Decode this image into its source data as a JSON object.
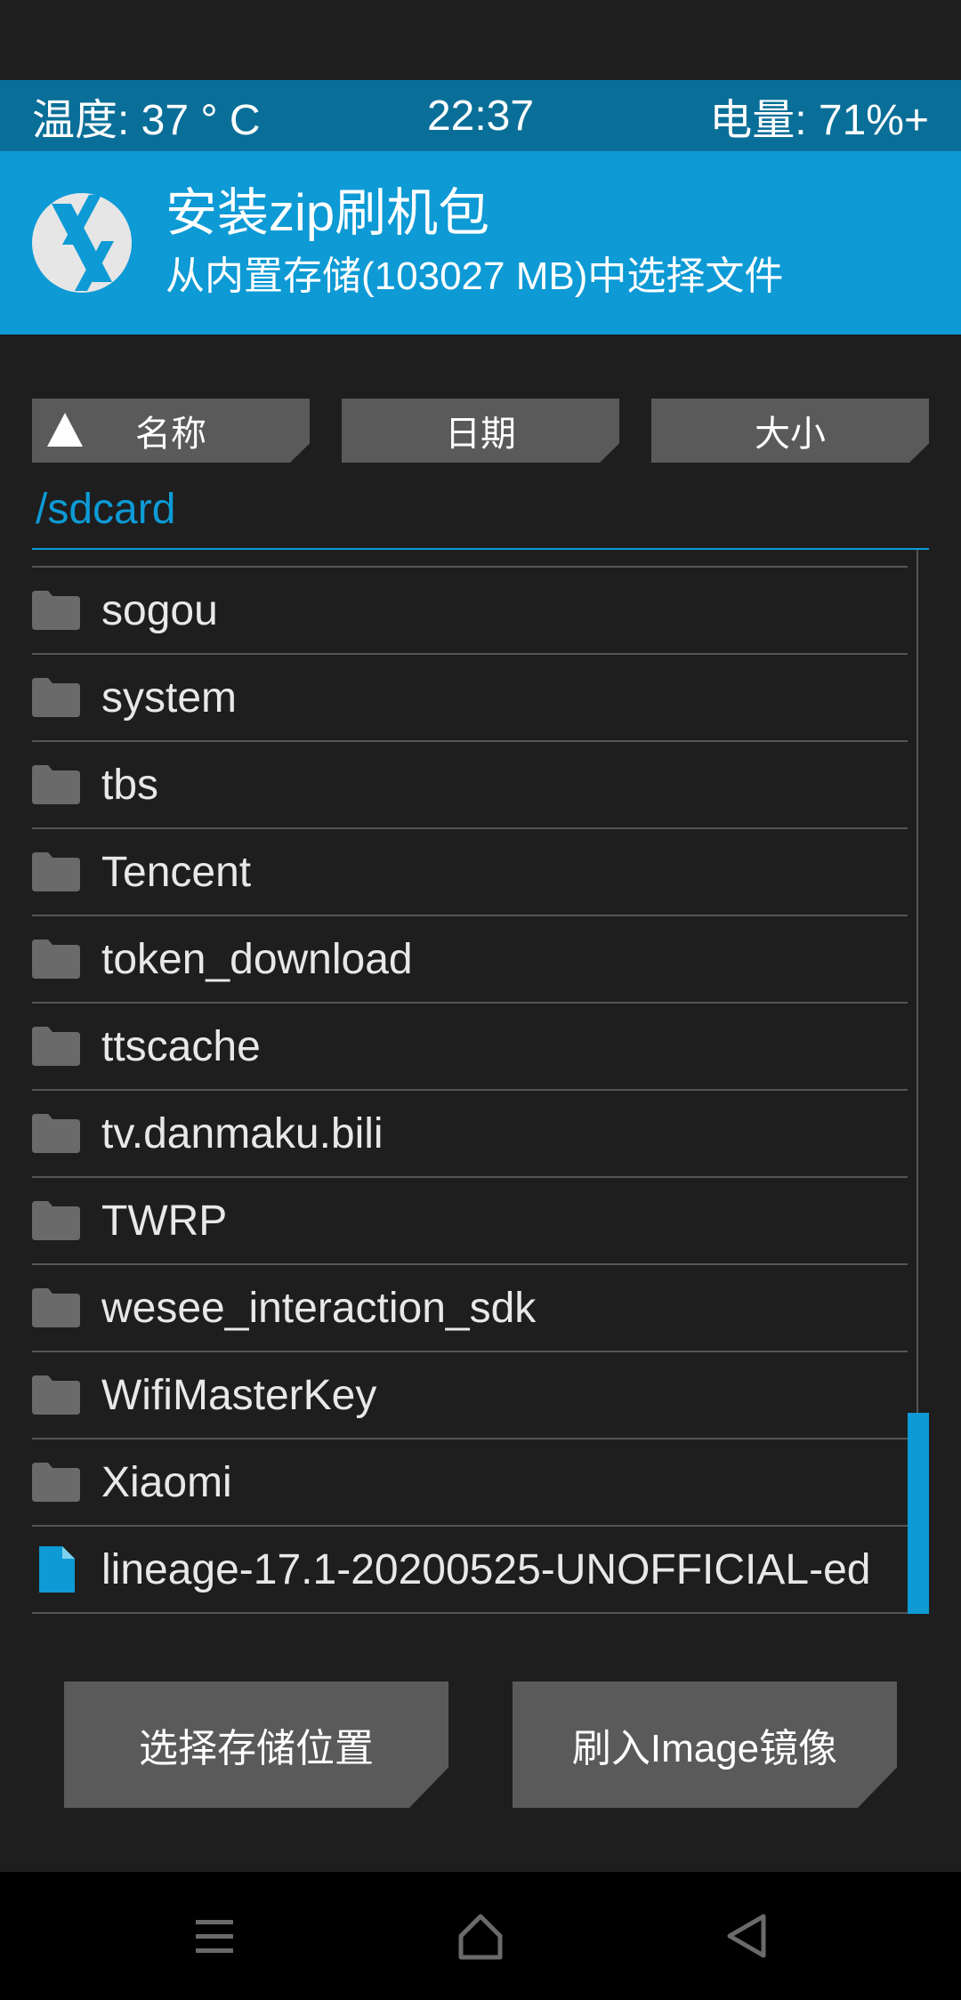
{
  "status_bar": {
    "temperature": "温度: 37 ° C",
    "time": "22:37",
    "battery": "电量: 71%+"
  },
  "header": {
    "title": "安装zip刷机包",
    "subtitle": "从内置存储(103027 MB)中选择文件",
    "logo_icon": "twrp-logo-icon"
  },
  "sort_buttons": {
    "name": "名称",
    "date": "日期",
    "size": "大小"
  },
  "current_path": "/sdcard",
  "files": [
    {
      "name": "sogou",
      "type": "folder"
    },
    {
      "name": "system",
      "type": "folder"
    },
    {
      "name": "tbs",
      "type": "folder"
    },
    {
      "name": "Tencent",
      "type": "folder"
    },
    {
      "name": "token_download",
      "type": "folder"
    },
    {
      "name": "ttscache",
      "type": "folder"
    },
    {
      "name": "tv.danmaku.bili",
      "type": "folder"
    },
    {
      "name": "TWRP",
      "type": "folder"
    },
    {
      "name": "wesee_interaction_sdk",
      "type": "folder"
    },
    {
      "name": "WifiMasterKey",
      "type": "folder"
    },
    {
      "name": "Xiaomi",
      "type": "folder"
    },
    {
      "name": "lineage-17.1-20200525-UNOFFICIAL-ed",
      "type": "file"
    }
  ],
  "buttons": {
    "select_storage": "选择存储位置",
    "flash_image": "刷入Image镜像"
  },
  "navbar": {
    "menu_icon": "menu-icon",
    "home_icon": "home-icon",
    "back_icon": "back-icon"
  },
  "colors": {
    "accent": "#0d9ad5",
    "status_bar": "#0a6f98",
    "background": "#1e1e1e",
    "button": "#5a5a5a",
    "folder_icon": "#6a6a6a"
  }
}
